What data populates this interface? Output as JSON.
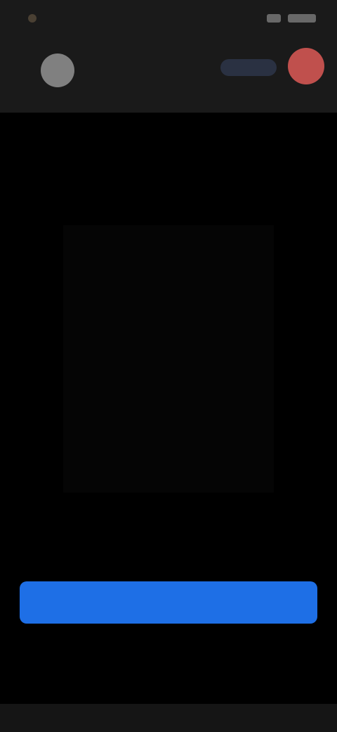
{
  "status_bar": {
    "time": ""
  },
  "top_bar": {
    "badge_label": ""
  },
  "header": {
    "message": ""
  },
  "primary_action": {
    "label": ""
  },
  "footer": {
    "caption": ""
  },
  "colors": {
    "background": "#000000",
    "bar": "#1a1a1a",
    "primary": "#1e6fe6",
    "end_call": "#c0504d"
  },
  "icons": {
    "back": "back-icon",
    "end": "end-call-icon"
  }
}
